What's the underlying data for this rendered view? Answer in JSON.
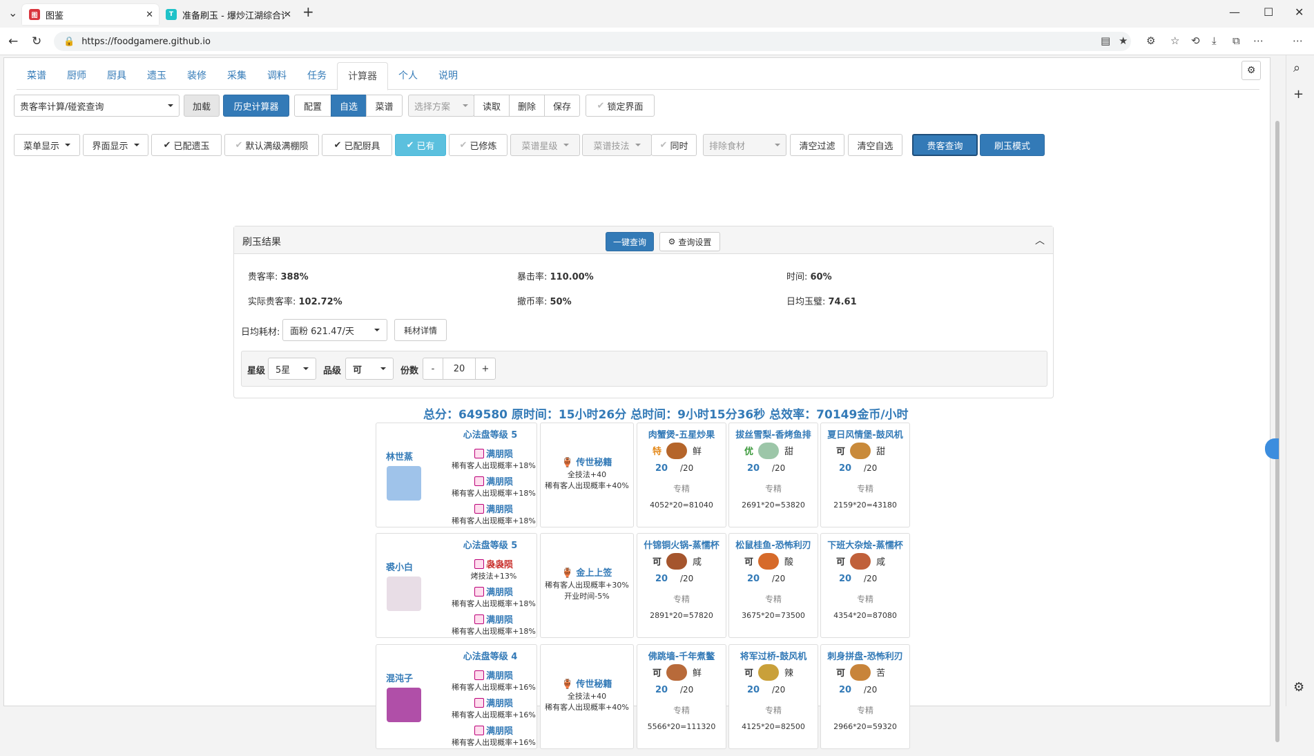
{
  "browser": {
    "tabs": [
      {
        "title": "图鉴",
        "favicon_color": "#d9363e",
        "active": true
      },
      {
        "title": "准备刷玉 - 爆炒江湖综合讨论 - Ta",
        "favicon_color": "#1fc2c8",
        "active": false
      }
    ],
    "url": "https://foodgamere.github.io"
  },
  "nav": {
    "tabs": [
      "菜谱",
      "厨师",
      "厨具",
      "遗玉",
      "装修",
      "采集",
      "调料",
      "任务",
      "计算器",
      "个人",
      "说明"
    ],
    "active": "计算器"
  },
  "toolbar1": {
    "mode_select": "贵客率计算/碰瓷查询",
    "load": "加载",
    "history": "历史计算器",
    "config": "配置",
    "custom": "自选",
    "recipes": "菜谱",
    "choose_plan": "选择方案",
    "read": "读取",
    "delete": "删除",
    "save": "保存",
    "lock_ui": "锁定界面"
  },
  "toolbar2": {
    "menu_display": "菜单显示",
    "ui_display": "界面显示",
    "equipped_jade": "已配遗玉",
    "default_full": "默认满级满棚陨",
    "equipped_tools": "已配厨具",
    "owned": "已有",
    "cultivated": "已修炼",
    "recipe_star": "菜谱星级",
    "recipe_skill": "菜谱技法",
    "same_time": "同时",
    "exclude_ingredient": "排除食材",
    "clear_filter": "清空过滤",
    "clear_custom": "清空自选",
    "guest_query": "贵客查询",
    "jade_mode": "刷玉模式"
  },
  "panel": {
    "title": "刷玉结果",
    "one_click": "一键查询",
    "query_settings": "查询设置",
    "stats": [
      {
        "label": "贵客率: ",
        "value": "388%"
      },
      {
        "label": "暴击率: ",
        "value": "110.00%"
      },
      {
        "label": "时间: ",
        "value": "60%"
      },
      {
        "label": "实际贵客率: ",
        "value": "102.72%"
      },
      {
        "label": "撤币率: ",
        "value": "50%"
      },
      {
        "label": "日均玉璧: ",
        "value": "74.61"
      }
    ],
    "daily_label": "日均耗材:",
    "daily_select": "面粉 621.47/天",
    "detail": "耗材详情",
    "star_label": "星级",
    "star_value": "5星",
    "grade_label": "品级",
    "grade_value": "可",
    "portion_label": "份数",
    "minus": "-",
    "portion_value": "20",
    "plus": "+"
  },
  "summary": "总分：649580 原时间：15小时26分 总时间：9小时15分36秒 总效率：70149金币/小时",
  "rows": [
    {
      "chef": "林世蒸",
      "avatar_color": "#9fc3ea",
      "level": "心法盘等级 5",
      "skills": [
        {
          "name": "满朋陨",
          "desc": "稀有客人出现概率+18%",
          "red": false
        },
        {
          "name": "满朋陨",
          "desc": "稀有客人出现概率+18%",
          "red": false
        },
        {
          "name": "满朋陨",
          "desc": "稀有客人出现概率+18%",
          "red": false
        }
      ],
      "equip": {
        "name": "传世秘籍",
        "desc": [
          "全技法+40",
          "稀有客人出现概率+40%"
        ]
      },
      "dishes": [
        {
          "name": "肉蟹煲-五星炒果",
          "grade": "特",
          "grade_color": "#e48a1c",
          "taste": "鲜",
          "food_color": "#b5652a",
          "qty": "20",
          "max": "/20",
          "spec": "专精",
          "score": "4052*20=81040"
        },
        {
          "name": "拔丝雪梨-香烤鱼排",
          "grade": "优",
          "grade_color": "#3c9a3c",
          "taste": "甜",
          "food_color": "#9cc6a8",
          "qty": "20",
          "max": "/20",
          "spec": "专精",
          "score": "2691*20=53820"
        },
        {
          "name": "夏日风情堡-鼓风机",
          "grade": "可",
          "grade_color": "#333333",
          "taste": "甜",
          "food_color": "#c98a3a",
          "qty": "20",
          "max": "/20",
          "spec": "专精",
          "score": "2159*20=43180"
        }
      ]
    },
    {
      "chef": "裘小白",
      "avatar_color": "#e8dde6",
      "level": "心法盘等级 5",
      "skills": [
        {
          "name": "袅袅陨",
          "desc": "烤技法+13%",
          "red": true
        },
        {
          "name": "满朋陨",
          "desc": "稀有客人出现概率+18%",
          "red": false
        },
        {
          "name": "满朋陨",
          "desc": "稀有客人出现概率+18%",
          "red": false
        }
      ],
      "equip": {
        "name": "金上上签",
        "desc": [
          "稀有客人出现概率+30%",
          "开业时间-5%"
        ]
      },
      "dishes": [
        {
          "name": "什锦铜火锅-蒸懦杯",
          "grade": "可",
          "grade_color": "#333333",
          "taste": "咸",
          "food_color": "#a5552d",
          "qty": "20",
          "max": "/20",
          "spec": "专精",
          "score": "2891*20=57820"
        },
        {
          "name": "松鼠桂鱼-恐怖利刃",
          "grade": "可",
          "grade_color": "#333333",
          "taste": "酸",
          "food_color": "#d66a2a",
          "qty": "20",
          "max": "/20",
          "spec": "专精",
          "score": "3675*20=73500"
        },
        {
          "name": "下班大杂烩-蒸懦杯",
          "grade": "可",
          "grade_color": "#333333",
          "taste": "咸",
          "food_color": "#c0603a",
          "qty": "20",
          "max": "/20",
          "spec": "专精",
          "score": "4354*20=87080"
        }
      ]
    },
    {
      "chef": "混沌子",
      "avatar_color": "#b04fa8",
      "level": "心法盘等级 4",
      "skills": [
        {
          "name": "满朋陨",
          "desc": "稀有客人出现概率+16%",
          "red": false
        },
        {
          "name": "满朋陨",
          "desc": "稀有客人出现概率+16%",
          "red": false
        },
        {
          "name": "满朋陨",
          "desc": "稀有客人出现概率+16%",
          "red": false
        }
      ],
      "equip": {
        "name": "传世秘籍",
        "desc": [
          "全技法+40",
          "稀有客人出现概率+40%"
        ]
      },
      "dishes": [
        {
          "name": "佛跳墙-千年煮鳖",
          "grade": "可",
          "grade_color": "#333333",
          "taste": "鲜",
          "food_color": "#b86a3a",
          "qty": "20",
          "max": "/20",
          "spec": "专精",
          "score": "5566*20=111320"
        },
        {
          "name": "将军过桥-鼓风机",
          "grade": "可",
          "grade_color": "#333333",
          "taste": "辣",
          "food_color": "#c9a03a",
          "qty": "20",
          "max": "/20",
          "spec": "专精",
          "score": "4125*20=82500"
        },
        {
          "name": "刺身拼盘-恐怖利刃",
          "grade": "可",
          "grade_color": "#333333",
          "taste": "苦",
          "food_color": "#c8843a",
          "qty": "20",
          "max": "/20",
          "spec": "专精",
          "score": "2966*20=59320"
        }
      ]
    }
  ]
}
